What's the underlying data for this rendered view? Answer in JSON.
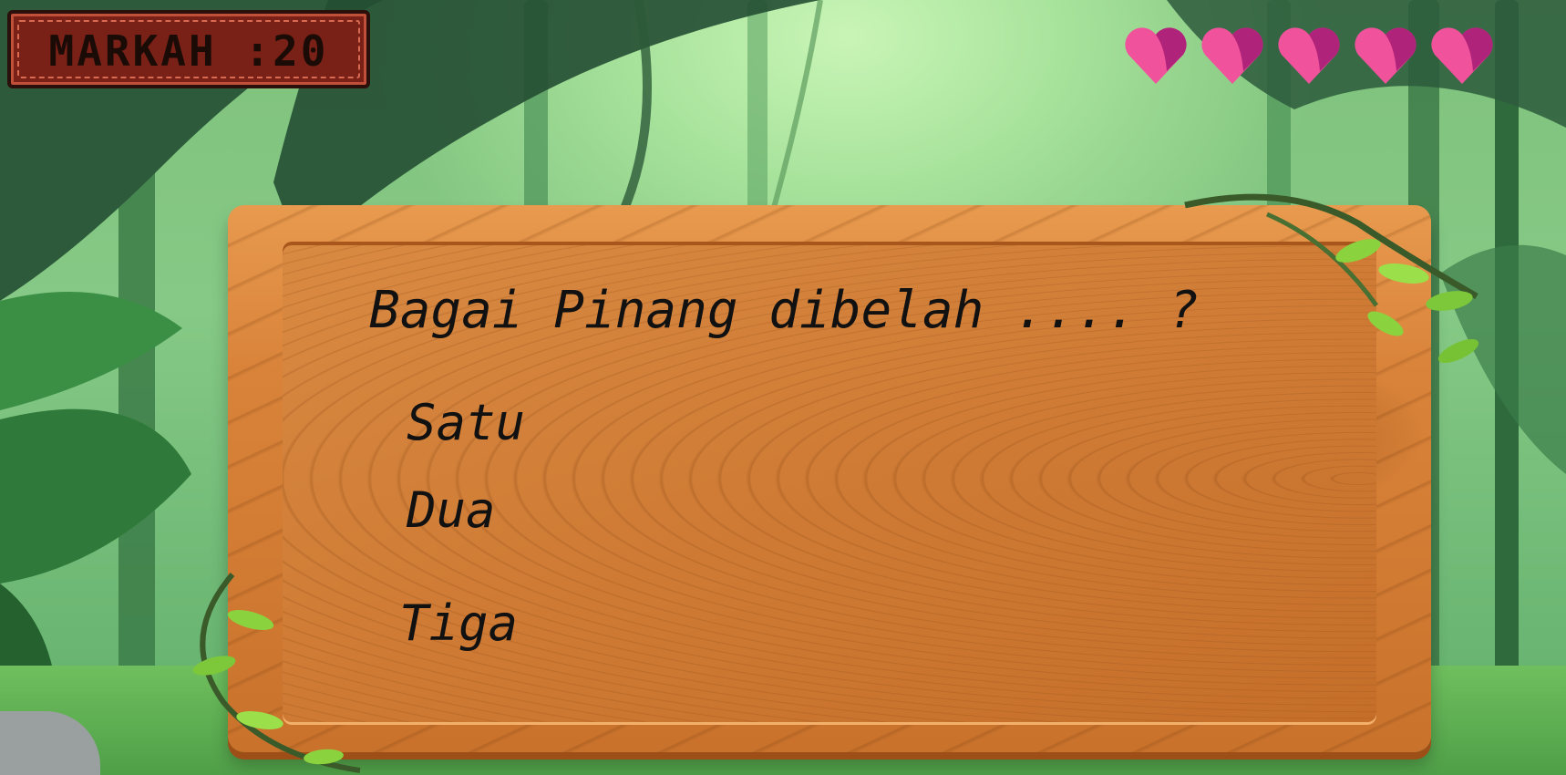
{
  "hud": {
    "score_label": "MARKAH :20",
    "lives": 5,
    "heart_colors": {
      "main": "#f0529c",
      "shade": "#b0237a"
    }
  },
  "quiz": {
    "question": "Bagai Pinang dibelah .... ?",
    "options": [
      "Satu",
      "Dua",
      "Tiga"
    ]
  },
  "colors": {
    "wood": "#d9833a",
    "score_box": "#7a2117",
    "jungle": "#86c986"
  }
}
